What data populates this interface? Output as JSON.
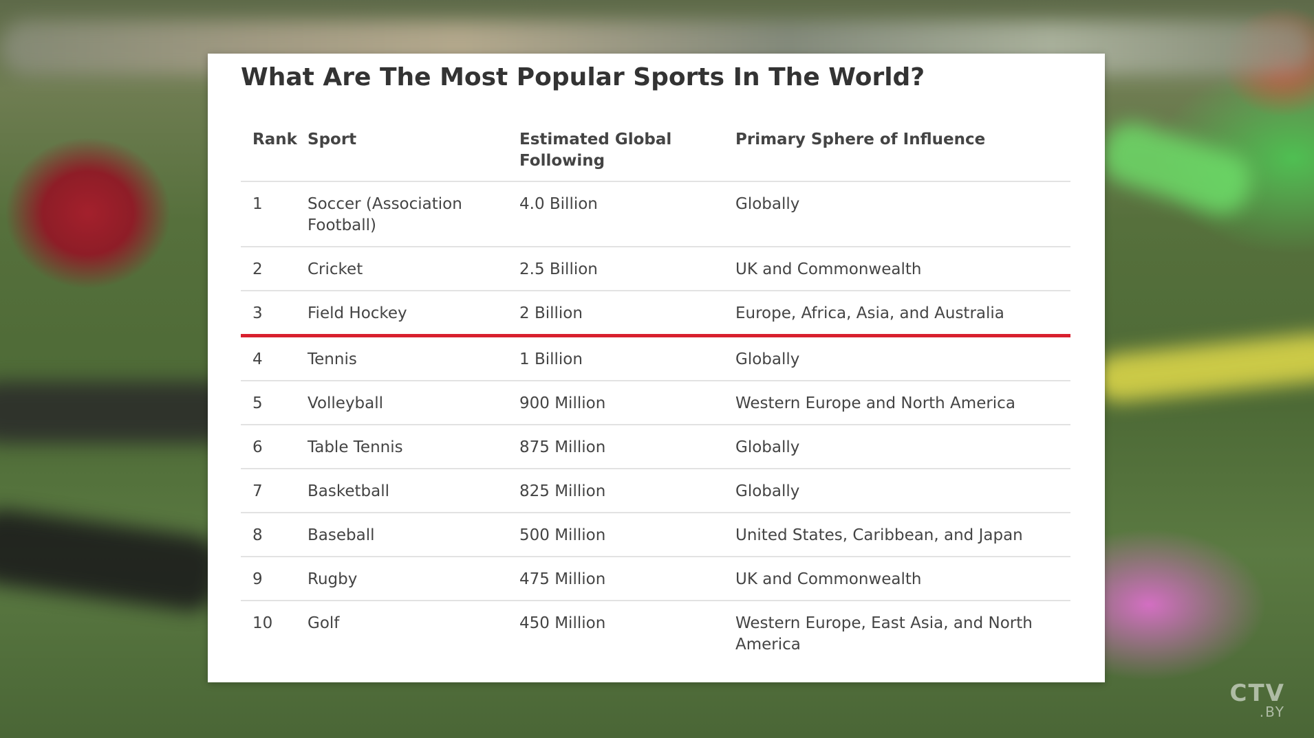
{
  "title": "What Are The Most Popular Sports In The World?",
  "watermark": {
    "main": "CTV",
    "sub": ".BY"
  },
  "highlight_color": "#d8202e",
  "table": {
    "headers": {
      "rank": "Rank",
      "sport": "Sport",
      "following": "Estimated Global Following",
      "sphere": "Primary Sphere of Influence"
    },
    "rows": [
      {
        "rank": "1",
        "sport": "Soccer (Association Football)",
        "following": "4.0 Billion",
        "sphere": "Globally"
      },
      {
        "rank": "2",
        "sport": "Cricket",
        "following": "2.5 Billion",
        "sphere": "UK and Commonwealth"
      },
      {
        "rank": "3",
        "sport": "Field Hockey",
        "following": "2 Billion",
        "sphere": "Europe, Africa, Asia, and Australia"
      },
      {
        "rank": "4",
        "sport": "Tennis",
        "following": "1 Billion",
        "sphere": "Globally"
      },
      {
        "rank": "5",
        "sport": "Volleyball",
        "following": "900 Million",
        "sphere": "Western Europe and North America"
      },
      {
        "rank": "6",
        "sport": "Table Tennis",
        "following": "875 Million",
        "sphere": "Globally"
      },
      {
        "rank": "7",
        "sport": "Basketball",
        "following": "825 Million",
        "sphere": "Globally"
      },
      {
        "rank": "8",
        "sport": "Baseball",
        "following": "500 Million",
        "sphere": "United States, Caribbean, and Japan"
      },
      {
        "rank": "9",
        "sport": "Rugby",
        "following": "475 Million",
        "sphere": "UK and Commonwealth"
      },
      {
        "rank": "10",
        "sport": "Golf",
        "following": "450 Million",
        "sphere": "Western Europe, East Asia, and North America"
      }
    ]
  }
}
